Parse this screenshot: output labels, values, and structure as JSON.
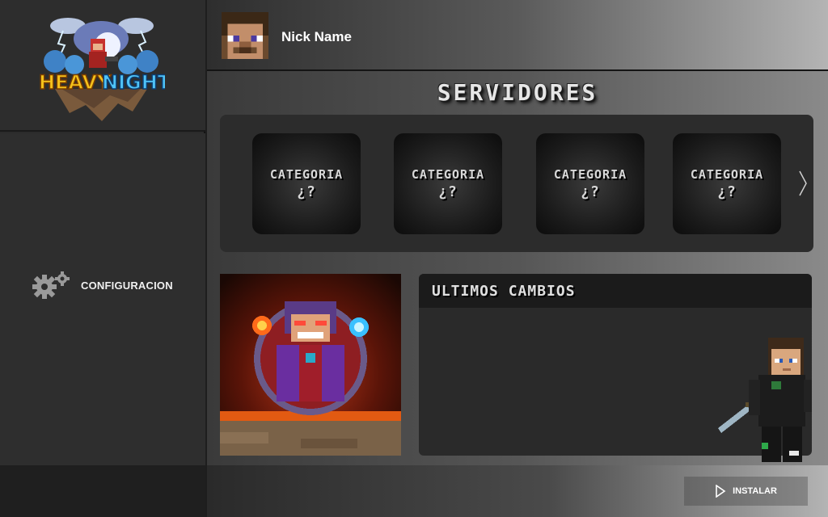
{
  "brand": {
    "logo_line1": "HEAVY",
    "logo_line2": "NIGHT",
    "logo_icon": "heavy-night-logo"
  },
  "sidebar": {
    "items": [
      {
        "label": "CONFIGURACION",
        "icon": "gear-icon"
      }
    ]
  },
  "header": {
    "nick_name": "Nick Name",
    "avatar_icon": "player-head-avatar"
  },
  "servers": {
    "title": "SERVIDORES",
    "categories": [
      {
        "label": "CATEGORIA",
        "sub": "¿?"
      },
      {
        "label": "CATEGORIA",
        "sub": "¿?"
      },
      {
        "label": "CATEGORIA",
        "sub": "¿?"
      },
      {
        "label": "CATEGORIA",
        "sub": "¿?"
      }
    ],
    "next_icon": "chevron-right-icon"
  },
  "changes": {
    "title": "ULTIMOS CAMBIOS"
  },
  "footer": {
    "install_label": "INSTALAR",
    "install_icon": "play-icon"
  },
  "colors": {
    "sidebar_bg": "#2b2b2b",
    "panel_bg": "#2c2c2c",
    "card_bg": "#1a1a1a",
    "text": "#ffffff"
  }
}
